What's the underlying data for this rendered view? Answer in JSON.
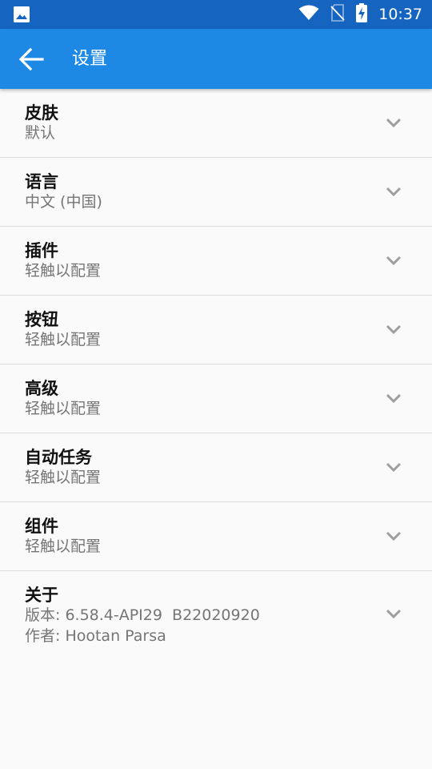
{
  "status_bar": {
    "time": "10:37",
    "icons": [
      "image-icon",
      "wifi-icon",
      "no-sim-icon",
      "battery-charging-icon"
    ]
  },
  "app_bar": {
    "title": "设置",
    "back_icon": "arrow-back-icon"
  },
  "settings": [
    {
      "title": "皮肤",
      "subtitle": "默认"
    },
    {
      "title": "语言",
      "subtitle": "中文 (中国)"
    },
    {
      "title": "插件",
      "subtitle": "轻触以配置"
    },
    {
      "title": "按钮",
      "subtitle": "轻触以配置"
    },
    {
      "title": "高级",
      "subtitle": "轻触以配置"
    },
    {
      "title": "自动任务",
      "subtitle": "轻触以配置"
    },
    {
      "title": "组件",
      "subtitle": "轻触以配置"
    },
    {
      "title": "关于",
      "subtitle": "版本: 6.58.4-API29  B22020920",
      "subtitle2": "作者: Hootan Parsa"
    }
  ],
  "colors": {
    "status_bar": "#1565c0",
    "app_bar": "#1e88e5",
    "background": "#fafafa",
    "divider": "#dcdcdc",
    "chevron": "#9e9e9e"
  }
}
